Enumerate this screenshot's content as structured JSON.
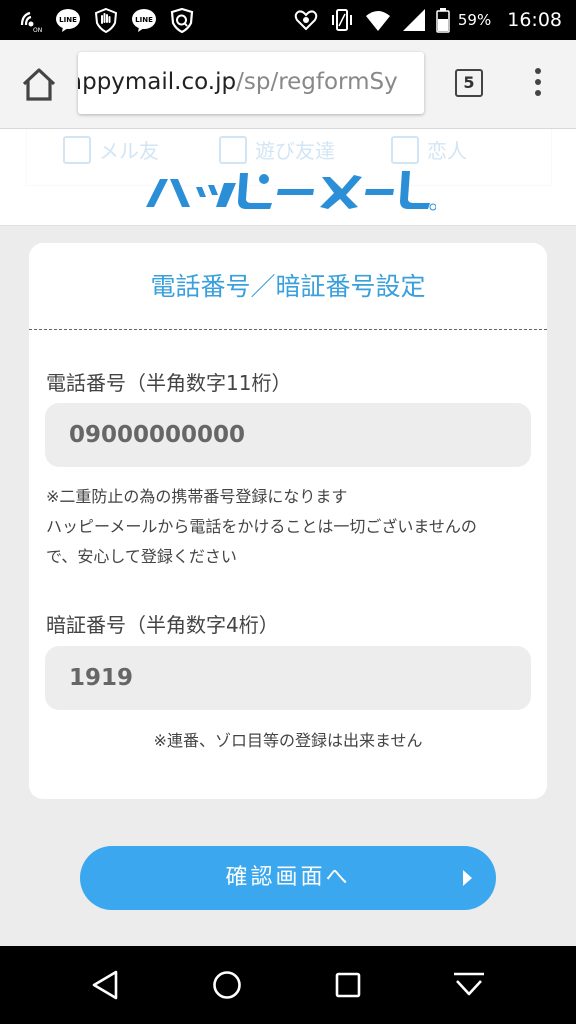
{
  "status_bar": {
    "left_icons": [
      "nfc-on-icon",
      "line-app-icon",
      "hand-shield-icon",
      "line-app-icon",
      "security-shield-icon"
    ],
    "right_icons": [
      "heart-notification-icon",
      "vibrate-icon",
      "wifi-icon",
      "signal-icon",
      "battery-icon"
    ],
    "battery_percent": "59%",
    "time": "16:08"
  },
  "browser": {
    "url_domain": "appymail.co.jp",
    "url_path": "/sp/regformSy",
    "tab_count": "5"
  },
  "banner": {
    "faded_checkbox_labels": [
      "メル友",
      "遊び友達",
      "恋人"
    ]
  },
  "form": {
    "title": "電話番号／暗証番号設定",
    "phone": {
      "label": "電話番号（半角数字11桁）",
      "value": "09000000000",
      "note_lines": [
        "※二重防止の為の携帯番号登録になります",
        "ハッピーメールから電話をかけることは一切ございませんの",
        "で、安心して登録ください"
      ]
    },
    "pin": {
      "label": "暗証番号（半角数字4桁）",
      "value": "1919",
      "note": "※連番、ゾロ目等の登録は出来ません"
    },
    "confirm_label": "確認画面へ"
  },
  "colors": {
    "accent": "#3aa0dc",
    "button": "#3aa7ee",
    "logo": "#2a8fd6"
  }
}
